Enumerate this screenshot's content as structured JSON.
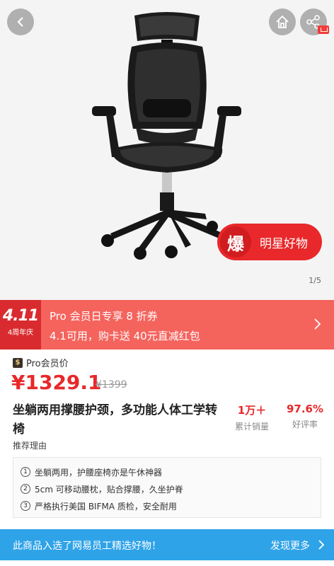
{
  "gallery": {
    "page_indicator": "1/5",
    "badge_char": "爆",
    "badge_label": "明星好物"
  },
  "icons": {
    "back": "chevron-left-icon",
    "home": "home-icon",
    "share": "share-icon"
  },
  "promo": {
    "logo_big": "4.11",
    "logo_small": "4周年庆",
    "line1": "Pro 会员日专享 8 折券",
    "line2": "4.1可用，购卡送 40元直减红包"
  },
  "price": {
    "pro_icon": "$",
    "pro_label": "Pro会员价",
    "current": "¥1329.1",
    "original": "¥1399"
  },
  "product": {
    "title": "坐躺两用撑腰护颈，多功能人体工学转椅",
    "sales_value": "1万＋",
    "sales_label": "累计销量",
    "rating_value": "97.6%",
    "rating_label": "好评率",
    "reason_title": "推荐理由",
    "reasons": [
      {
        "num": "1",
        "text": "坐躺两用，护腰座椅亦是午休神器"
      },
      {
        "num": "2",
        "text": "5cm 可移动腰枕，贴合撑腰，久坐护脊"
      },
      {
        "num": "3",
        "text": "严格执行美国 BIFMA 质检，安全耐用"
      }
    ]
  },
  "bottom_bar": {
    "text": "此商品入选了网易员工精选好物！",
    "more": "发现更多"
  },
  "colors": {
    "accent_red": "#e8282a",
    "promo_bg": "#f5635d",
    "bottom_bar_bg": "#2fa3e8"
  }
}
